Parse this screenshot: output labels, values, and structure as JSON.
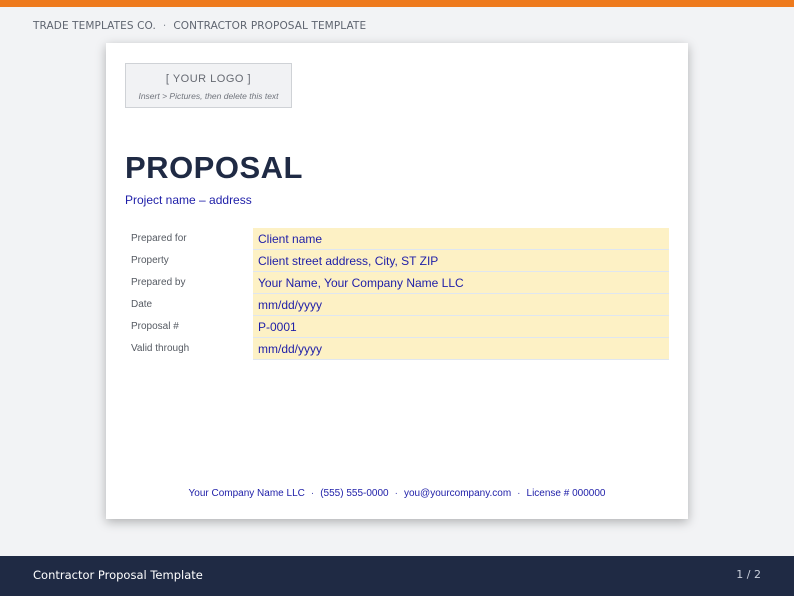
{
  "header": {
    "company": "TRADE TEMPLATES CO.",
    "separator": "·",
    "template": "CONTRACTOR PROPOSAL TEMPLATE"
  },
  "document": {
    "logo_title": "[ YOUR LOGO ]",
    "logo_hint": "Insert > Pictures, then delete this text",
    "title": "PROPOSAL",
    "subtitle": "Project name – address",
    "fields": [
      {
        "label": "Prepared for",
        "value": "Client name"
      },
      {
        "label": "Property",
        "value": "Client street address, City, ST ZIP"
      },
      {
        "label": "Prepared by",
        "value": "Your Name, Your Company Name LLC"
      },
      {
        "label": "Date",
        "value": "mm/dd/yyyy"
      },
      {
        "label": "Proposal #",
        "value": "P-0001"
      },
      {
        "label": "Valid through",
        "value": "mm/dd/yyyy"
      }
    ],
    "footer": {
      "company": "Your Company Name LLC",
      "phone": "(555) 555-0000",
      "email": "you@yourcompany.com",
      "license": "License # 000000",
      "separator": "·"
    }
  },
  "bottom_bar": {
    "title": "Contractor Proposal Template",
    "page": "1 / 2"
  },
  "colors": {
    "accent": "#ee7a1d",
    "navy": "#1f2a44",
    "field_fill": "#fdf1c5",
    "value_text": "#1e1ea8"
  }
}
